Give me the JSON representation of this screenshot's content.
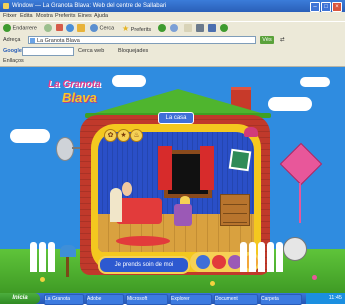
{
  "browser": {
    "title": "Window — La Granota Blava: Web del centre de Sallabari",
    "menu": [
      "Fitxer",
      "Edita",
      "Mostra",
      "Preferits",
      "Eines",
      "Ajuda"
    ],
    "toolbar": {
      "back_label": "Endarrere",
      "search_label": "Cerca",
      "favorites_label": "Preferits"
    },
    "address": {
      "label": "Adreça",
      "value": "La Granota Blava",
      "go_label": "Vés"
    },
    "google": {
      "label": "Google",
      "search_label": "Cerca web",
      "extra": "Bloquejades"
    },
    "links": {
      "label": "Enllaços"
    }
  },
  "page": {
    "logo": {
      "line1": "La Granota",
      "line2": "Blava"
    },
    "room_label": "La casa",
    "caption": "Je prends soin de moi",
    "tool_icons": [
      "gear-icon",
      "star-icon",
      "fire-icon"
    ]
  },
  "taskbar": {
    "start_label": "Inicia",
    "tasks": [
      "La Granota",
      "Adobe",
      "Microsoft",
      "Explorer",
      "Document",
      "Carpeta"
    ],
    "clock": "11:45"
  },
  "colors": {
    "sky": "#2f8ce0",
    "grass": "#4fb52e",
    "house": "#c0392b",
    "frame": "#f4c81f",
    "titlebar": "#2a5fb8"
  }
}
